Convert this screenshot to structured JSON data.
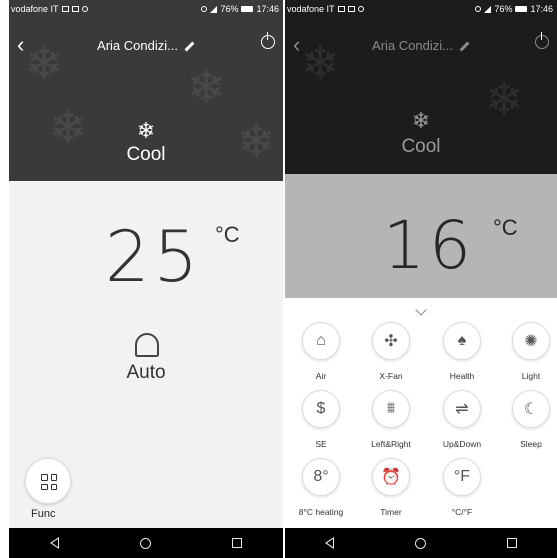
{
  "left": {
    "status": {
      "carrier": "vodafone IT",
      "battery": "76%",
      "time": "17:46"
    },
    "header": {
      "device_name": "Aria Condizi..."
    },
    "mode": {
      "icon": "snowflake-icon",
      "glyph": "❄",
      "label": "Cool"
    },
    "temperature": {
      "value": "25",
      "unit": "°C"
    },
    "fan": {
      "icon": "fan-icon",
      "label": "Auto"
    },
    "func": {
      "label": "Func"
    }
  },
  "right": {
    "status": {
      "carrier": "vodafone IT",
      "battery": "76%",
      "time": "17:46"
    },
    "header": {
      "device_name": "Aria Condizi..."
    },
    "mode": {
      "icon": "snowflake-icon",
      "glyph": "❄",
      "label": "Cool"
    },
    "temperature": {
      "value": "16",
      "unit": "°C"
    },
    "functions": [
      {
        "label": "Air",
        "icon": "air-icon",
        "glyph": "⌂"
      },
      {
        "label": "X-Fan",
        "icon": "x-fan-icon",
        "glyph": "✣"
      },
      {
        "label": "Health",
        "icon": "health-icon",
        "glyph": "♠"
      },
      {
        "label": "Light",
        "icon": "light-icon",
        "glyph": "✺"
      },
      {
        "label": "SE",
        "icon": "se-icon",
        "glyph": "$"
      },
      {
        "label": "Left&Right",
        "icon": "left-right-swing-icon",
        "glyph": "⩩"
      },
      {
        "label": "Up&Down",
        "icon": "up-down-swing-icon",
        "glyph": "⇌"
      },
      {
        "label": "Sleep",
        "icon": "sleep-icon",
        "glyph": "☾"
      },
      {
        "label": "8°C heating",
        "icon": "heating-8c-icon",
        "glyph": "8°"
      },
      {
        "label": "Timer",
        "icon": "timer-icon",
        "glyph": "⏰"
      },
      {
        "label": "°C/°F",
        "icon": "unit-toggle-icon",
        "glyph": "°F"
      }
    ]
  },
  "colors": {
    "hero_left": "#3a3a3a",
    "hero_right": "#1c1c1c",
    "panel": "#ffffff"
  }
}
